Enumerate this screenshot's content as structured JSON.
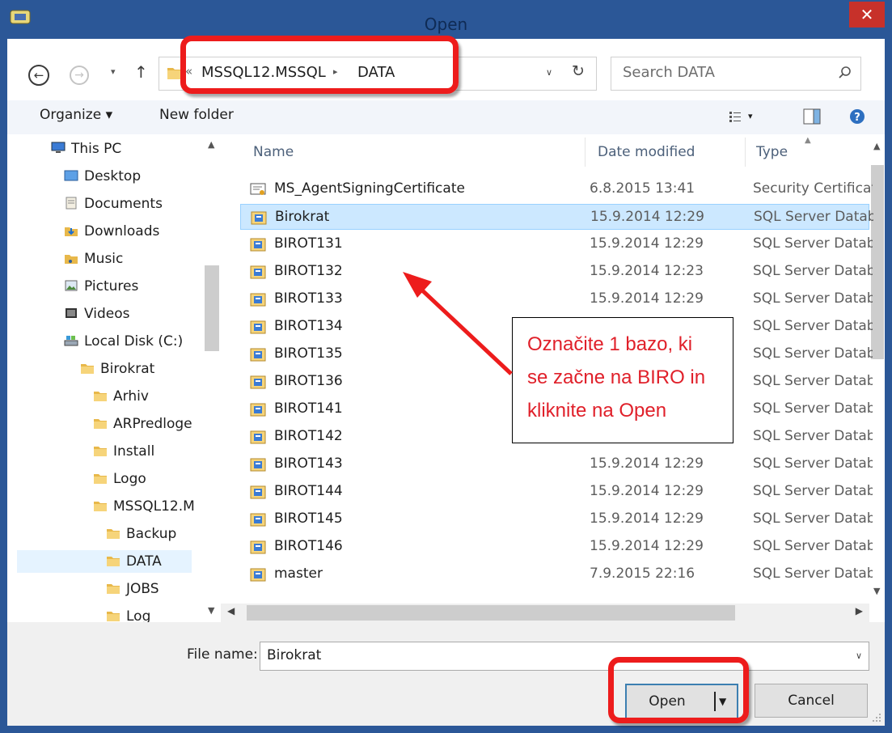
{
  "window": {
    "title": "Open",
    "close_glyph": "✕"
  },
  "nav": {
    "back_glyph": "←",
    "forward_glyph": "→",
    "recent_glyph": "▾",
    "up_glyph": "↑"
  },
  "address": {
    "overflow": "«",
    "segments": [
      "MSSQL12.MSSQL",
      "DATA"
    ],
    "separator": "▸",
    "dropdown_glyph": "∨",
    "refresh_glyph": "↻"
  },
  "search": {
    "placeholder": "Search DATA"
  },
  "toolbar": {
    "organize": "Organize ▾",
    "new_folder": "New folder",
    "views_dd": "▾"
  },
  "sidebar": {
    "items": [
      {
        "label": "This PC",
        "icon": "pc-icon"
      },
      {
        "label": "Desktop",
        "icon": "desktop-icon"
      },
      {
        "label": "Documents",
        "icon": "documents-icon"
      },
      {
        "label": "Downloads",
        "icon": "downloads-icon"
      },
      {
        "label": "Music",
        "icon": "music-icon"
      },
      {
        "label": "Pictures",
        "icon": "pictures-icon"
      },
      {
        "label": "Videos",
        "icon": "videos-icon"
      },
      {
        "label": "Local Disk (C:)",
        "icon": "drive-icon"
      },
      {
        "label": "Birokrat",
        "icon": "folder-icon"
      },
      {
        "label": "Arhiv",
        "icon": "folder-icon"
      },
      {
        "label": "ARPredloge",
        "icon": "folder-icon"
      },
      {
        "label": "Install",
        "icon": "folder-icon"
      },
      {
        "label": "Logo",
        "icon": "folder-icon"
      },
      {
        "label": "MSSQL12.M",
        "icon": "folder-icon"
      },
      {
        "label": "Backup",
        "icon": "folder-icon"
      },
      {
        "label": "DATA",
        "icon": "folder-icon"
      },
      {
        "label": "JOBS",
        "icon": "folder-icon"
      },
      {
        "label": "Log",
        "icon": "folder-icon"
      }
    ],
    "selected": "DATA"
  },
  "columns": {
    "name": "Name",
    "date": "Date modified",
    "type": "Type"
  },
  "files": [
    {
      "name": "MS_AgentSigningCertificate",
      "date": "6.8.2015 13:41",
      "type": "Security Certificate",
      "icon": "certificate-icon"
    },
    {
      "name": "Birokrat",
      "date": "15.9.2014 12:29",
      "type": "SQL Server Database",
      "icon": "database-file-icon"
    },
    {
      "name": "BIROT131",
      "date": "15.9.2014 12:29",
      "type": "SQL Server Database",
      "icon": "database-file-icon"
    },
    {
      "name": "BIROT132",
      "date": "15.9.2014 12:23",
      "type": "SQL Server Database",
      "icon": "database-file-icon"
    },
    {
      "name": "BIROT133",
      "date": "15.9.2014 12:29",
      "type": "SQL Server Database",
      "icon": "database-file-icon"
    },
    {
      "name": "BIROT134",
      "date": "",
      "type": "SQL Server Database",
      "icon": "database-file-icon"
    },
    {
      "name": "BIROT135",
      "date": "",
      "type": "SQL Server Database",
      "icon": "database-file-icon"
    },
    {
      "name": "BIROT136",
      "date": "",
      "type": "SQL Server Database",
      "icon": "database-file-icon"
    },
    {
      "name": "BIROT141",
      "date": "",
      "type": "SQL Server Database",
      "icon": "database-file-icon"
    },
    {
      "name": "BIROT142",
      "date": "",
      "type": "SQL Server Database",
      "icon": "database-file-icon"
    },
    {
      "name": "BIROT143",
      "date": "15.9.2014 12:29",
      "type": "SQL Server Database",
      "icon": "database-file-icon"
    },
    {
      "name": "BIROT144",
      "date": "15.9.2014 12:29",
      "type": "SQL Server Database",
      "icon": "database-file-icon"
    },
    {
      "name": "BIROT145",
      "date": "15.9.2014 12:29",
      "type": "SQL Server Database",
      "icon": "database-file-icon"
    },
    {
      "name": "BIROT146",
      "date": "15.9.2014 12:29",
      "type": "SQL Server Database",
      "icon": "database-file-icon"
    },
    {
      "name": "master",
      "date": "7.9.2015 22:16",
      "type": "SQL Server Database",
      "icon": "database-file-icon"
    }
  ],
  "selected_file": "Birokrat",
  "filename": {
    "label": "File name:",
    "value": "Birokrat",
    "dropdown_glyph": "∨"
  },
  "buttons": {
    "open": "Open",
    "open_dd": "▼",
    "cancel": "Cancel"
  },
  "annotation": {
    "lines": [
      "Označite 1 bazo, ki",
      "se začne na BIRO in",
      "kliknite na Open"
    ],
    "color": "#e0202a"
  },
  "highlight_color": "#ed1c1c",
  "accent": "#2b5797"
}
